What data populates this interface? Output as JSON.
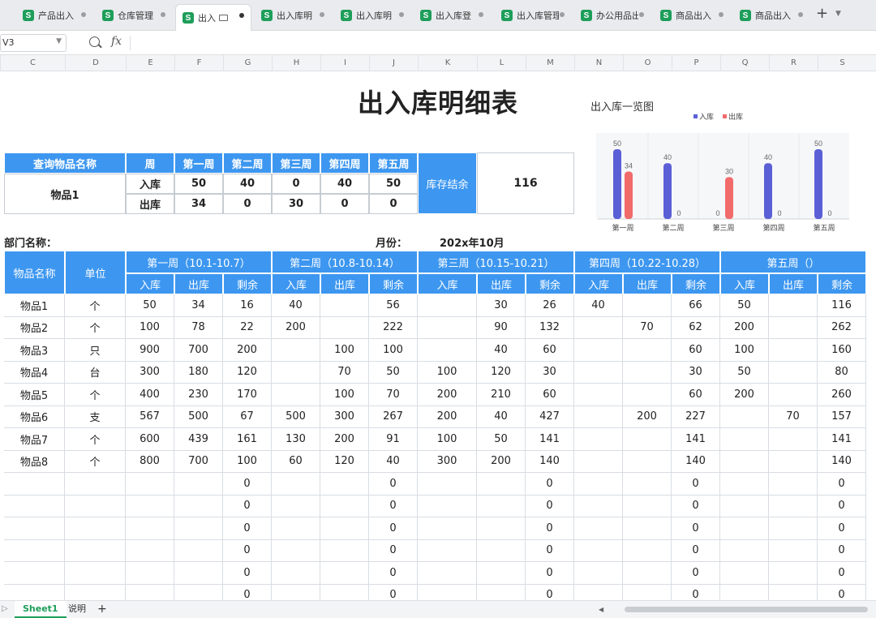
{
  "tabs": [
    {
      "label": "产品出入",
      "active": false
    },
    {
      "label": "仓库管理",
      "active": false
    },
    {
      "label": "出入",
      "active": true
    },
    {
      "label": "出入库明",
      "active": false
    },
    {
      "label": "出入库明",
      "active": false
    },
    {
      "label": "出入库登",
      "active": false
    },
    {
      "label": "出入库管理",
      "active": false
    },
    {
      "label": "办公用品出入",
      "active": false
    },
    {
      "label": "商品出入",
      "active": false
    },
    {
      "label": "商品出入",
      "active": false
    }
  ],
  "tab_icon_letter": "S",
  "new_tab": "+",
  "formula_bar": {
    "name_box": "V3",
    "fx": "fx",
    "content": ""
  },
  "columns": [
    "C",
    "D",
    "E",
    "F",
    "G",
    "H",
    "I",
    "J",
    "K",
    "L",
    "M",
    "N",
    "O",
    "P",
    "Q",
    "R",
    "S"
  ],
  "title": "出入库明细表",
  "query": {
    "name_header": "查询物品名称",
    "week_header": "周",
    "weeks": [
      "第一周",
      "第二周",
      "第三周",
      "第四周",
      "第五周"
    ],
    "item": "物品1",
    "in_label": "入库",
    "out_label": "出库",
    "in_values": [
      "50",
      "40",
      "0",
      "40",
      "50"
    ],
    "out_values": [
      "34",
      "0",
      "30",
      "0",
      "0"
    ],
    "balance_label": "库存结余",
    "balance_value": "116"
  },
  "chart_data": {
    "type": "bar",
    "title": "出入库一览图",
    "categories": [
      "第一周",
      "第二周",
      "第三周",
      "第四周",
      "第五周"
    ],
    "series": [
      {
        "name": "入库",
        "values": [
          50,
          40,
          0,
          40,
          50
        ],
        "color": "#5b5fd6"
      },
      {
        "name": "出库",
        "values": [
          34,
          0,
          30,
          0,
          0
        ],
        "color": "#f26b6b"
      }
    ],
    "ylim": [
      0,
      50
    ],
    "legend": "top-right",
    "data_labels": true,
    "grid": "vertical"
  },
  "dept_label": "部门名称：",
  "month_label": "月份：",
  "month_value": "202x年10月",
  "main_table": {
    "name_header": "物品名称",
    "unit_header": "单位",
    "week_headers": [
      "第一周（10.1-10.7）",
      "第二周（10.8-10.14）",
      "第三周（10.15-10.21）",
      "第四周（10.22-10.28）",
      "第五周（）"
    ],
    "sub_headers": [
      "入库",
      "出库",
      "剩余"
    ],
    "rows": [
      [
        "物品1",
        "个",
        "50",
        "34",
        "16",
        "40",
        "",
        "56",
        "",
        "30",
        "26",
        "40",
        "",
        "66",
        "50",
        "",
        "116"
      ],
      [
        "物品2",
        "个",
        "100",
        "78",
        "22",
        "200",
        "",
        "222",
        "",
        "90",
        "132",
        "",
        "70",
        "62",
        "200",
        "",
        "262"
      ],
      [
        "物品3",
        "只",
        "900",
        "700",
        "200",
        "",
        "100",
        "100",
        "",
        "40",
        "60",
        "",
        "",
        "60",
        "100",
        "",
        "160"
      ],
      [
        "物品4",
        "台",
        "300",
        "180",
        "120",
        "",
        "70",
        "50",
        "100",
        "120",
        "30",
        "",
        "",
        "30",
        "50",
        "",
        "80"
      ],
      [
        "物品5",
        "个",
        "400",
        "230",
        "170",
        "",
        "100",
        "70",
        "200",
        "210",
        "60",
        "",
        "",
        "60",
        "200",
        "",
        "260"
      ],
      [
        "物品6",
        "支",
        "567",
        "500",
        "67",
        "500",
        "300",
        "267",
        "200",
        "40",
        "427",
        "",
        "200",
        "227",
        "",
        "70",
        "157"
      ],
      [
        "物品7",
        "个",
        "600",
        "439",
        "161",
        "130",
        "200",
        "91",
        "100",
        "50",
        "141",
        "",
        "",
        "141",
        "",
        "",
        "141"
      ],
      [
        "物品8",
        "个",
        "800",
        "700",
        "100",
        "60",
        "120",
        "40",
        "300",
        "200",
        "140",
        "",
        "",
        "140",
        "",
        "",
        "140"
      ],
      [
        "",
        "",
        "",
        "",
        "0",
        "",
        "",
        "0",
        "",
        "",
        "0",
        "",
        "",
        "0",
        "",
        "",
        "0"
      ],
      [
        "",
        "",
        "",
        "",
        "0",
        "",
        "",
        "0",
        "",
        "",
        "0",
        "",
        "",
        "0",
        "",
        "",
        "0"
      ],
      [
        "",
        "",
        "",
        "",
        "0",
        "",
        "",
        "0",
        "",
        "",
        "0",
        "",
        "",
        "0",
        "",
        "",
        "0"
      ],
      [
        "",
        "",
        "",
        "",
        "0",
        "",
        "",
        "0",
        "",
        "",
        "0",
        "",
        "",
        "0",
        "",
        "",
        "0"
      ],
      [
        "",
        "",
        "",
        "",
        "0",
        "",
        "",
        "0",
        "",
        "",
        "0",
        "",
        "",
        "0",
        "",
        "",
        "0"
      ],
      [
        "",
        "",
        "",
        "",
        "0",
        "",
        "",
        "0",
        "",
        "",
        "0",
        "",
        "",
        "0",
        "",
        "",
        "0"
      ]
    ]
  },
  "statusbar": {
    "sheets": [
      "Sheet1",
      "说明"
    ],
    "add": "+"
  },
  "colors": {
    "header_blue": "#3d97f0",
    "sheet_green": "#1e9e5a"
  }
}
